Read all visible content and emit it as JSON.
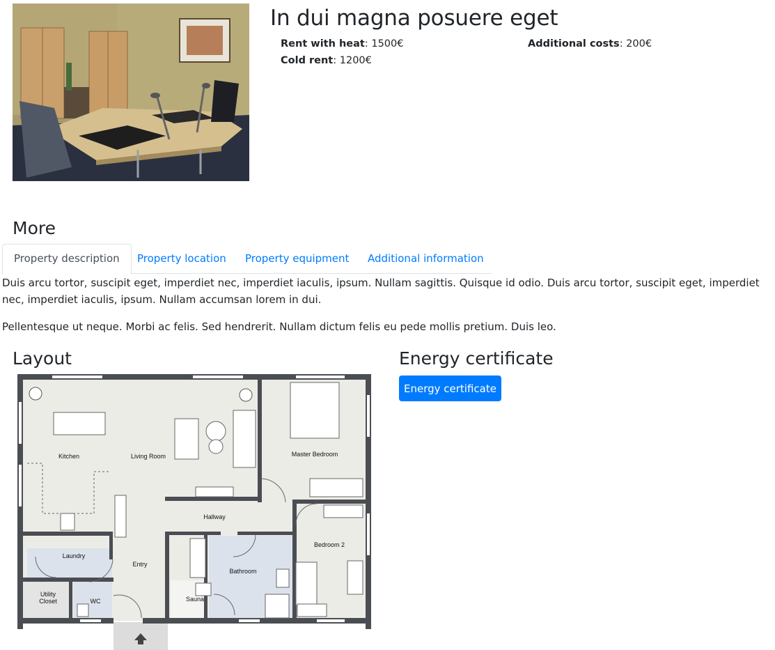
{
  "listing": {
    "title": "In dui magna posuere eget",
    "rent_with_heat_label": "Rent with heat",
    "rent_with_heat_value": ": 1500€",
    "cold_rent_label": "Cold rent",
    "cold_rent_value": ": 1200€",
    "additional_costs_label": "Additional costs",
    "additional_costs_value": ": 200€"
  },
  "more": {
    "heading": "More",
    "tabs": [
      {
        "label": "Property description",
        "active": true
      },
      {
        "label": "Property location",
        "active": false
      },
      {
        "label": "Property equipment",
        "active": false
      },
      {
        "label": "Additional information",
        "active": false
      }
    ],
    "paragraphs": [
      "Duis arcu tortor, suscipit eget, imperdiet nec, imperdiet iaculis, ipsum. Nullam sagittis. Quisque id odio. Duis arcu tortor, suscipit eget, imperdiet nec, imperdiet iaculis, ipsum. Nullam accumsan lorem in dui.",
      "Pellentesque ut neque. Morbi ac felis. Sed hendrerit. Nullam dictum felis eu pede mollis pretium. Duis leo."
    ]
  },
  "layout": {
    "heading": "Layout",
    "rooms": {
      "kitchen": "Kitchen",
      "living_room": "Living Room",
      "master_bedroom": "Master Bedroom",
      "hallway": "Hallway",
      "laundry": "Laundry",
      "entry": "Entry",
      "bathroom": "Bathroom",
      "bedroom2": "Bedroom 2",
      "utility_line1": "Utility",
      "utility_line2": "Closet",
      "wc": "WC",
      "sauna": "Sauna"
    }
  },
  "energy": {
    "heading": "Energy certificate",
    "button_label": "Energy certificate"
  },
  "colors": {
    "primary": "#007bff",
    "text": "#212529",
    "tab_border": "#dee2e6",
    "floor_wall": "#4a4d52",
    "floor_living": "#ecece6",
    "floor_wet": "#dce2ec"
  }
}
